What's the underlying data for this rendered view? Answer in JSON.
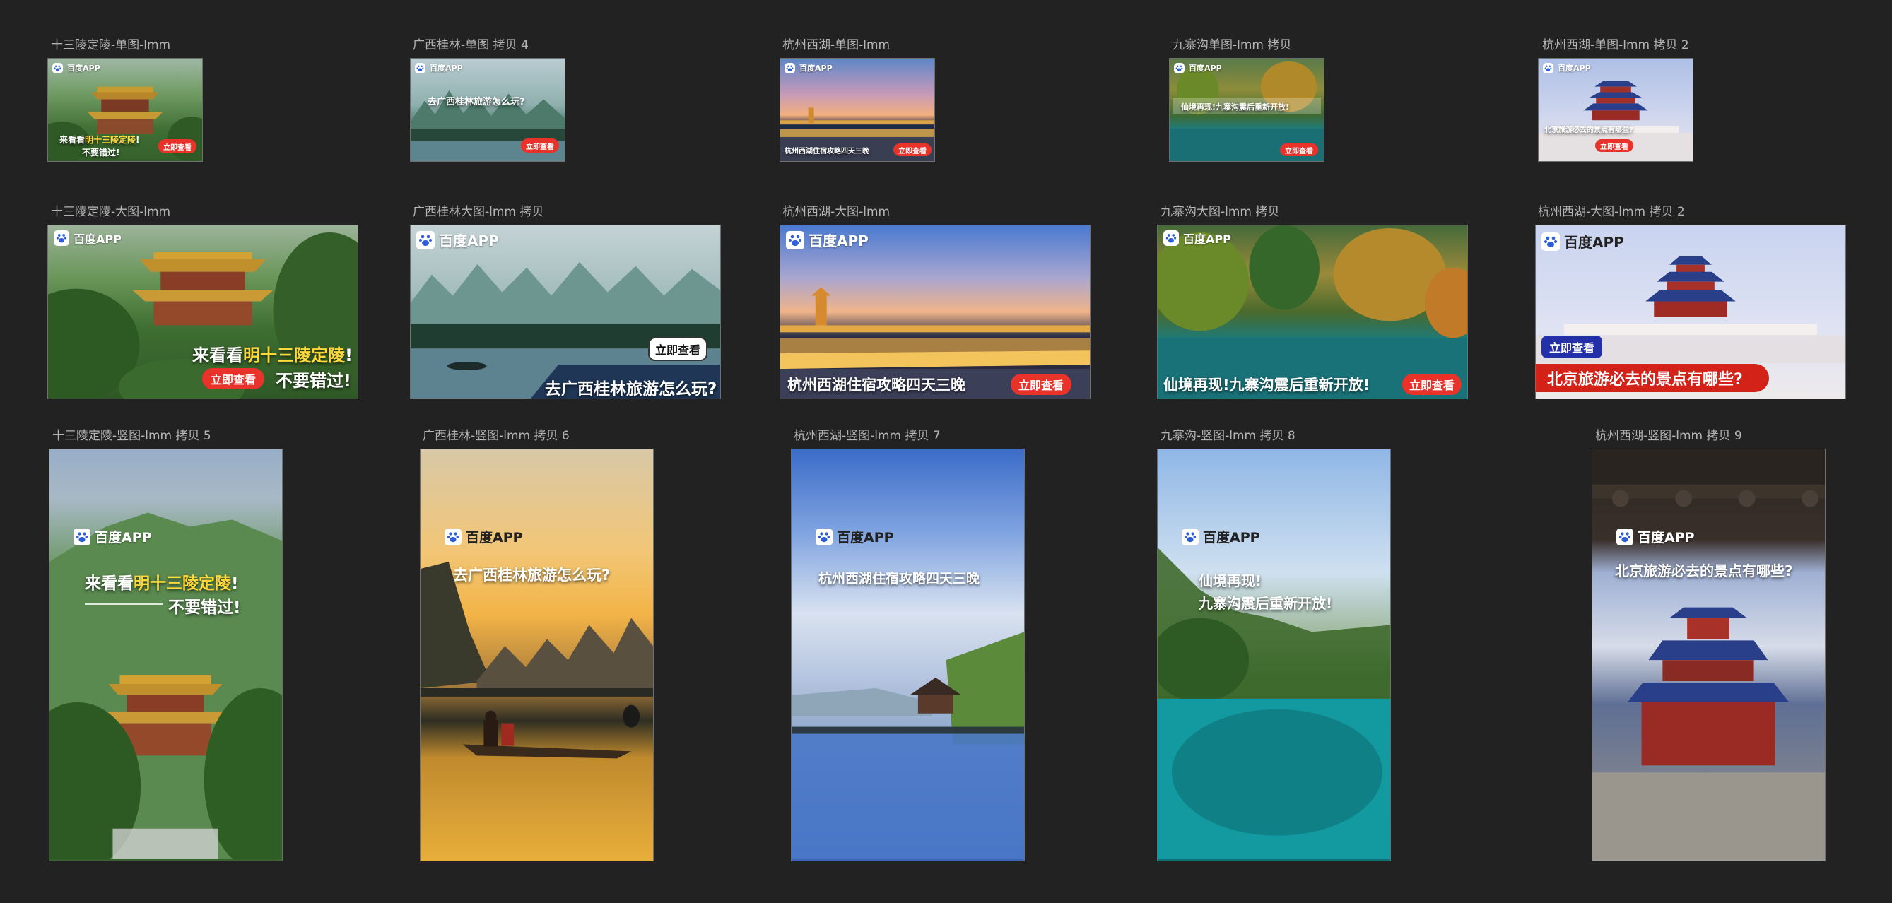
{
  "labels": {
    "row1": [
      "十三陵定陵-单图-lmm",
      "广西桂林-单图 拷贝 4",
      "杭州西湖-单图-lmm",
      "九寨沟单图-lmm 拷贝",
      "杭州西湖-单图-lmm 拷贝 2"
    ],
    "row2": [
      "十三陵定陵-大图-lmm",
      "广西桂林大图-lmm 拷贝",
      "杭州西湖-大图-lmm",
      "九寨沟大图-lmm  拷贝",
      "杭州西湖-大图-lmm  拷贝 2"
    ],
    "row3": [
      "十三陵定陵-竖图-lmm 拷贝 5",
      "广西桂林-竖图-lmm 拷贝 6",
      "杭州西湖-竖图-lmm 拷贝 7",
      "九寨沟-竖图-lmm 拷贝 8",
      "杭州西湖-竖图-lmm 拷贝 9"
    ]
  },
  "ad": {
    "logo": "百度APP",
    "cta": "立即查看",
    "ming": {
      "h1_pre": "来看看",
      "h1_hl": "明十三陵定陵",
      "h1_post": "!",
      "h2": "不要错过!"
    },
    "guilin": {
      "headline": "去广西桂林旅游怎么玩?"
    },
    "westlake": {
      "headline": "杭州西湖住宿攻略四天三晚"
    },
    "jiuzhai": {
      "headline": "仙境再现!九寨沟震后重新开放!",
      "line1": "仙境再现!",
      "line2": "九寨沟震后重新开放!"
    },
    "beijing": {
      "headline": "北京旅游必去的景点有哪些?"
    }
  },
  "colors": {
    "canvas_bg": "#222222",
    "label_text": "#b4b4b4",
    "cta_red": "#e8322a",
    "cta_blue": "#2330a8",
    "highlight_yellow": "#ffd83a",
    "banner_red": "#d32218"
  },
  "icons": {
    "logo": "baidu-paw-icon"
  }
}
